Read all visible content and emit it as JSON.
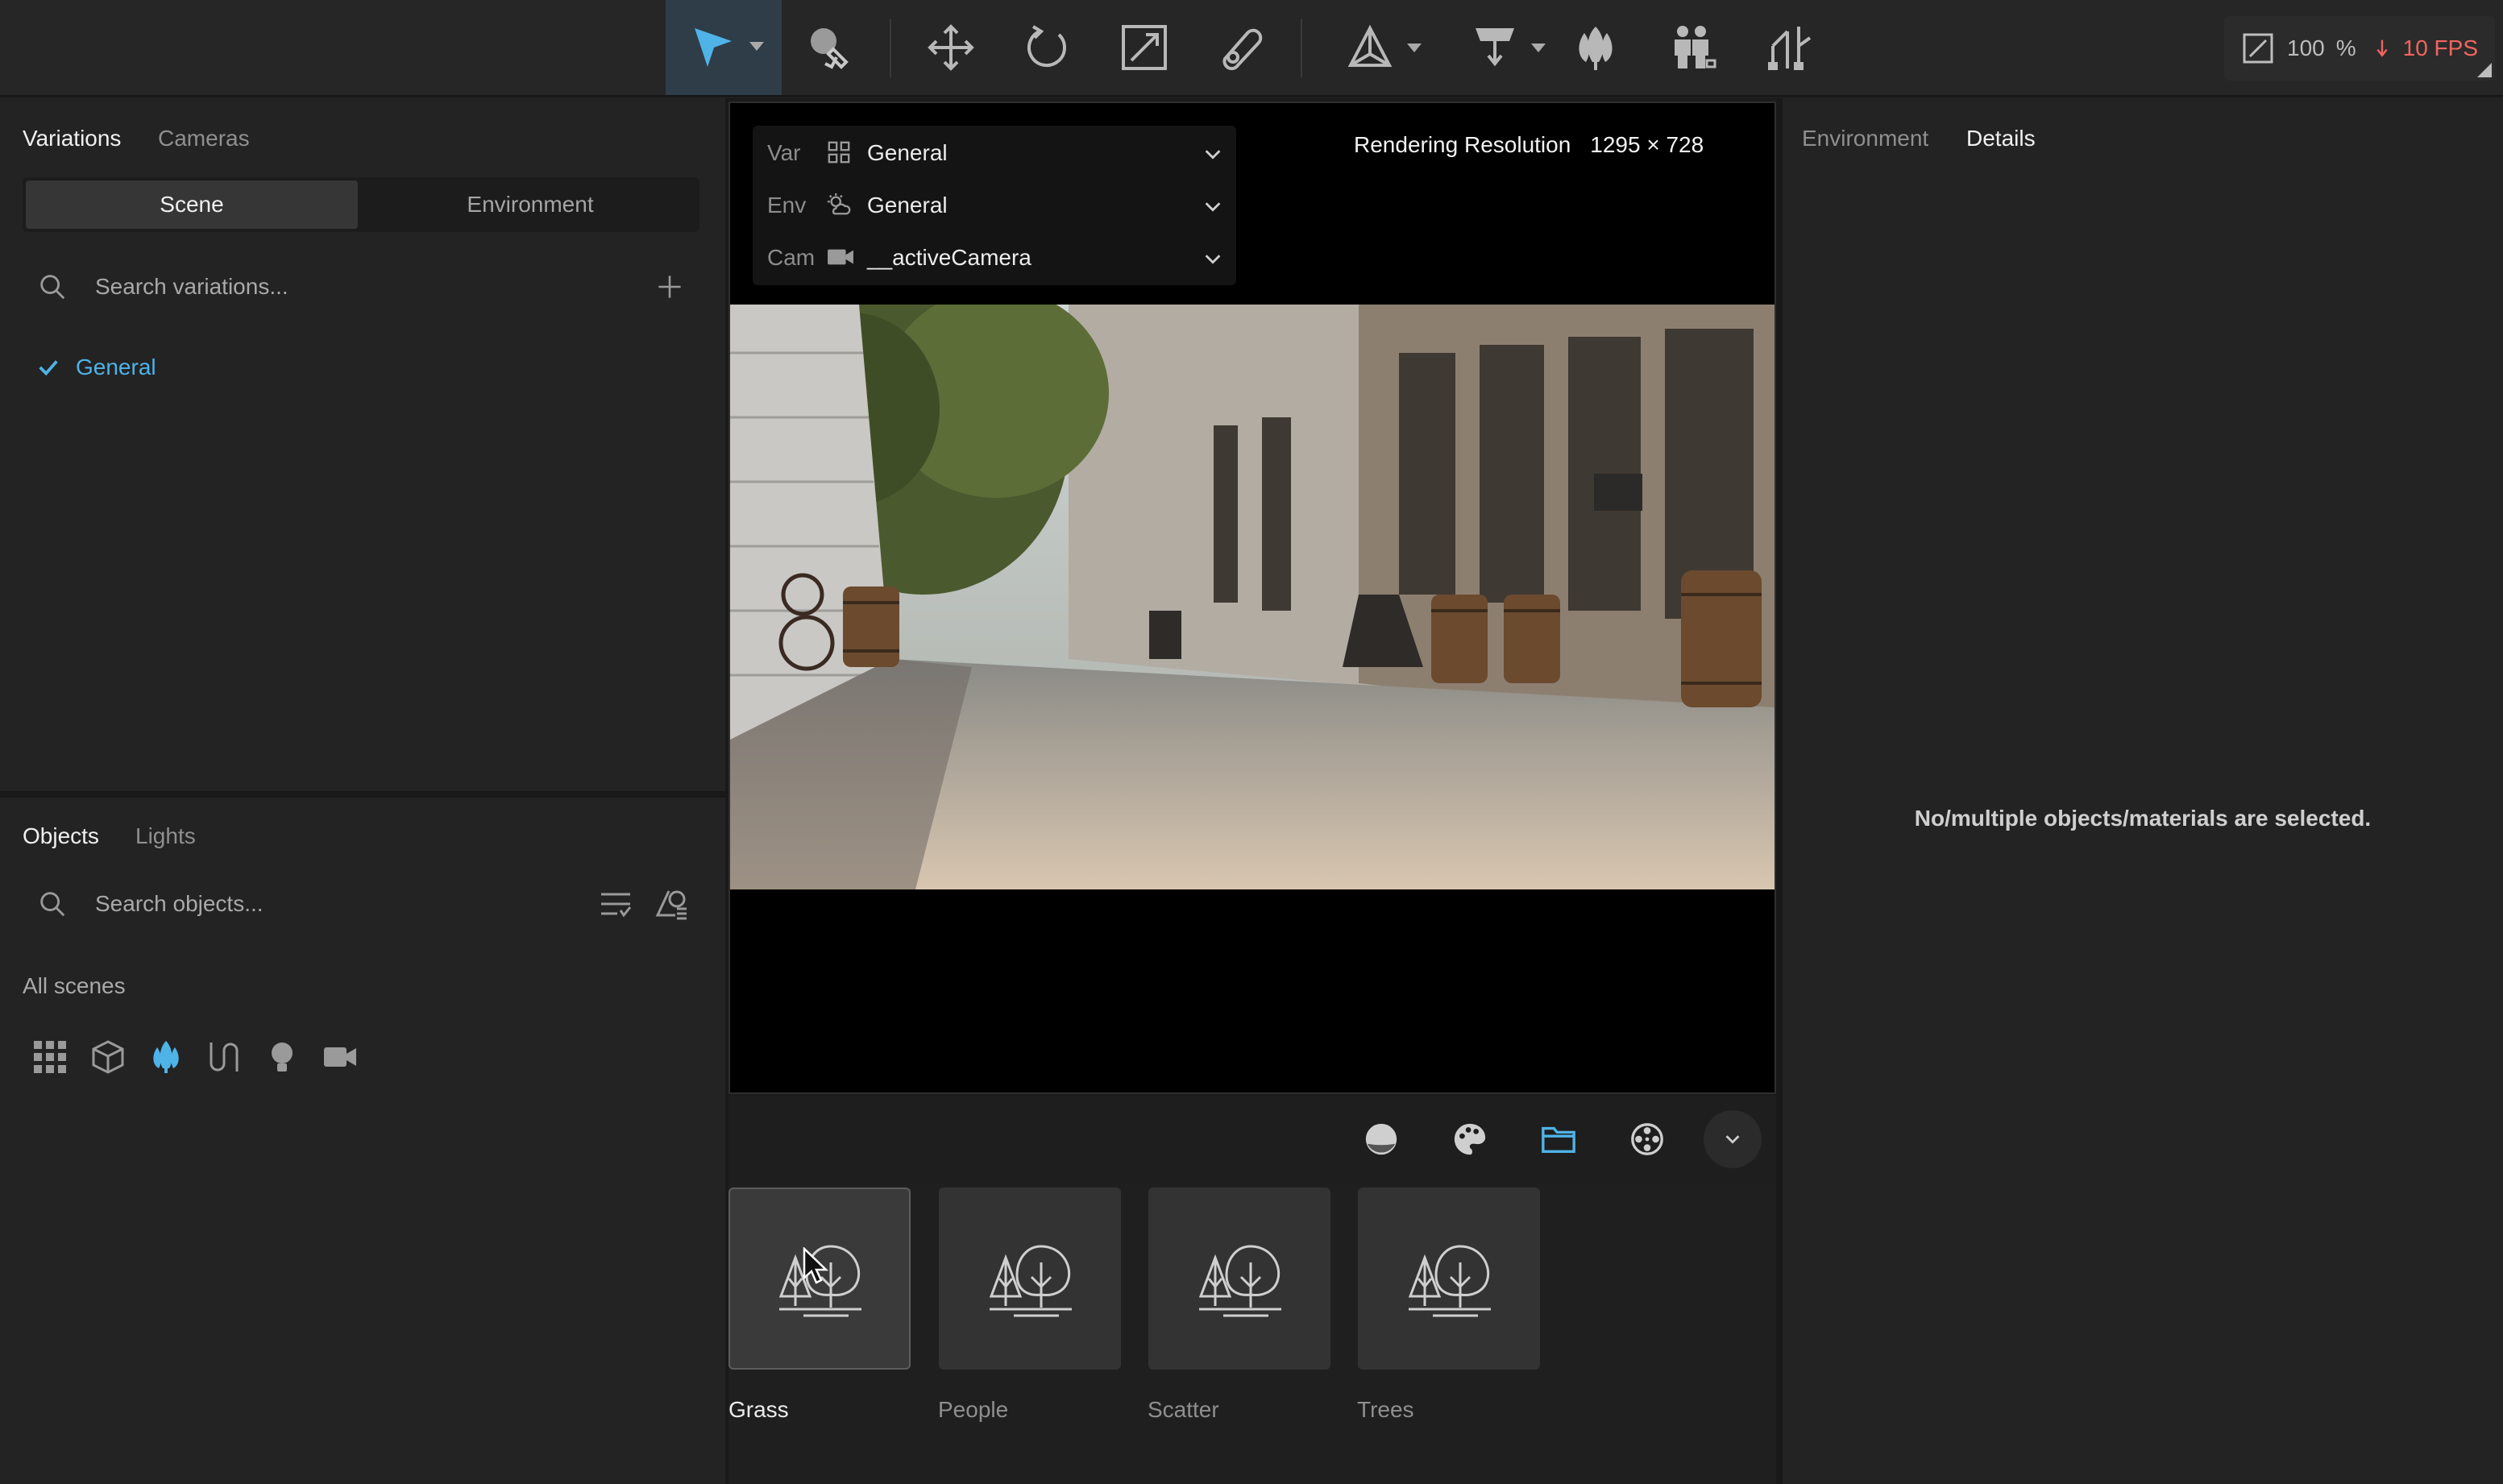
{
  "toolbar": {
    "tools": [
      {
        "name": "select-tool",
        "icon": "cursor-arrow-icon",
        "active": true
      },
      {
        "name": "paint-tool",
        "icon": "brush-icon"
      },
      {
        "name": "move-tool",
        "icon": "move-arrows-icon"
      },
      {
        "name": "rotate-tool",
        "icon": "rotate-icon"
      },
      {
        "name": "scale-tool",
        "icon": "scale-icon"
      },
      {
        "name": "measure-tool",
        "icon": "tape-measure-icon"
      },
      {
        "name": "snap-tool",
        "icon": "snap-axes-icon"
      },
      {
        "name": "placement-tool",
        "icon": "placement-icon"
      },
      {
        "name": "scatter-tool",
        "icon": "tree-scatter-icon"
      },
      {
        "name": "people-tool",
        "icon": "people-icon"
      },
      {
        "name": "path-tool",
        "icon": "path-icon"
      }
    ],
    "accent": "#4fb3e8",
    "zoom_value": "100",
    "zoom_unit": "%",
    "fps": "10 FPS",
    "fps_color": "#f0655f"
  },
  "variations_panel": {
    "tabs": [
      "Variations",
      "Cameras"
    ],
    "segments": [
      "Scene",
      "Environment"
    ],
    "search_placeholder": "Search variations...",
    "items": [
      {
        "label": "General",
        "checked": true
      }
    ]
  },
  "objects_panel": {
    "tabs": [
      "Objects",
      "Lights"
    ],
    "search_placeholder": "Search objects...",
    "section_label": "All scenes",
    "filter_icons": [
      "grid-icon",
      "cube-icon",
      "tree-icon",
      "path-icon",
      "bulb-icon",
      "camera-icon"
    ]
  },
  "viewport": {
    "dropdowns": [
      {
        "key": "Var",
        "icon": "variation-icon",
        "value": "General"
      },
      {
        "key": "Env",
        "icon": "sun-cloud-icon",
        "value": "General"
      },
      {
        "key": "Cam",
        "icon": "camera-icon",
        "value": "__activeCamera"
      }
    ],
    "resolution_label": "Rendering Resolution",
    "resolution_value": "1295 × 728",
    "render_description": "render-preview"
  },
  "asset_bar": {
    "buttons": [
      "material-sphere-icon",
      "palette-icon",
      "folder-icon",
      "film-reel-icon",
      "chevron-down-icon"
    ],
    "active_button": "folder-icon"
  },
  "asset_cards": [
    {
      "label": "Grass",
      "selected": true
    },
    {
      "label": "People"
    },
    {
      "label": "Scatter"
    },
    {
      "label": "Trees"
    }
  ],
  "right_panel": {
    "tabs": [
      "Environment",
      "Details"
    ],
    "empty_message": "No/multiple objects/materials are selected."
  }
}
